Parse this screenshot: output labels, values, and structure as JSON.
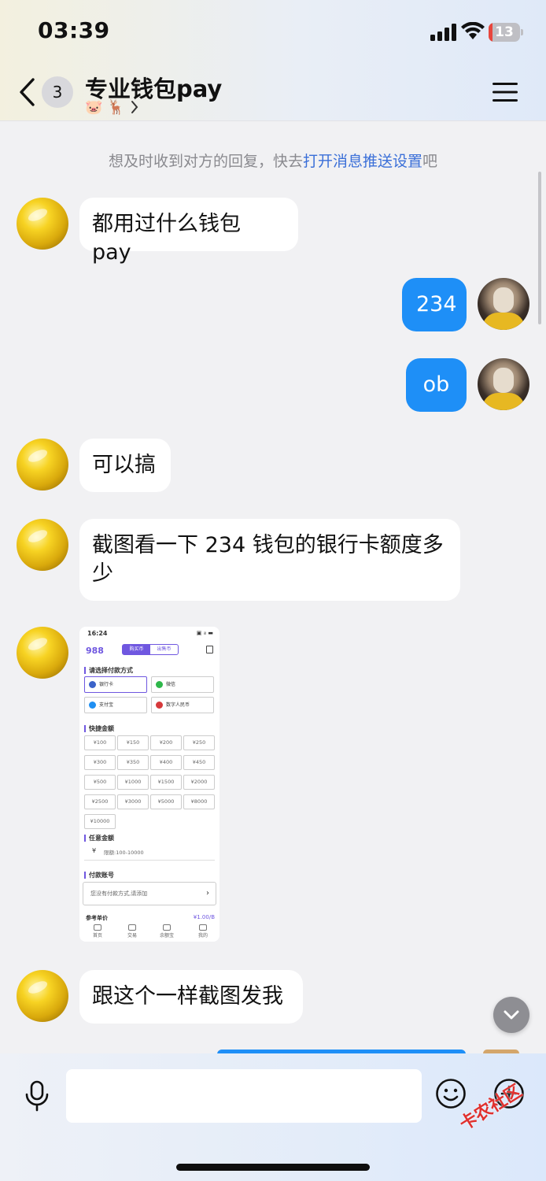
{
  "status_bar": {
    "time": "03:39",
    "battery": "13",
    "battery_level": 0.13
  },
  "header": {
    "back_count": "3",
    "title": "专业钱包pay",
    "subtitle_emojis": "🐷 🦌"
  },
  "notice": {
    "prefix": "想及时收到对方的回复，快去",
    "link": "打开消息推送设置",
    "suffix": "吧"
  },
  "messages": [
    {
      "side": "left",
      "text": "都用过什么钱包 pay"
    },
    {
      "side": "right",
      "text": "234"
    },
    {
      "side": "right",
      "text": "ob"
    },
    {
      "side": "left",
      "text": "可以搞"
    },
    {
      "side": "left",
      "text": "截图看一下 234 钱包的银行卡额度多少"
    },
    {
      "side": "left",
      "type": "image"
    },
    {
      "side": "left",
      "text": "跟这个一样截图发我"
    }
  ],
  "shared_screenshot": {
    "time": "16:24",
    "status_right": "▣ ᵢₗₗ ▬",
    "logo": "988",
    "tabs": [
      "购买币",
      "出售币"
    ],
    "section_payment": "请选择付款方式",
    "payment_methods": [
      {
        "label": "银行卡",
        "color": "#3b63c9"
      },
      {
        "label": "微信",
        "color": "#2eb74a"
      },
      {
        "label": "支付宝",
        "color": "#1f8ff2"
      },
      {
        "label": "数字人民币",
        "color": "#d6393b"
      }
    ],
    "section_quick": "快捷金额",
    "amounts": [
      "¥100",
      "¥150",
      "¥200",
      "¥250",
      "¥300",
      "¥350",
      "¥400",
      "¥450",
      "¥500",
      "¥1000",
      "¥1500",
      "¥2000",
      "¥2500",
      "¥3000",
      "¥5000",
      "¥8000",
      "¥10000"
    ],
    "section_any": "任意金额",
    "any_placeholder": "限额:100-10000",
    "currency_sign": "¥",
    "section_account": "付款账号",
    "account_placeholder": "您没有付款方式,请添加",
    "account_chevron": "›",
    "ref_label": "参考单价",
    "ref_value": "¥1.00/B",
    "nav": [
      "首页",
      "交易",
      "余额宝",
      "我的"
    ]
  },
  "composer": {
    "placeholder": ""
  },
  "watermark": "卡农社区",
  "colors": {
    "accent": "#1e8ff7",
    "link": "#3a6fd8",
    "app_purple": "#6f57e0"
  }
}
